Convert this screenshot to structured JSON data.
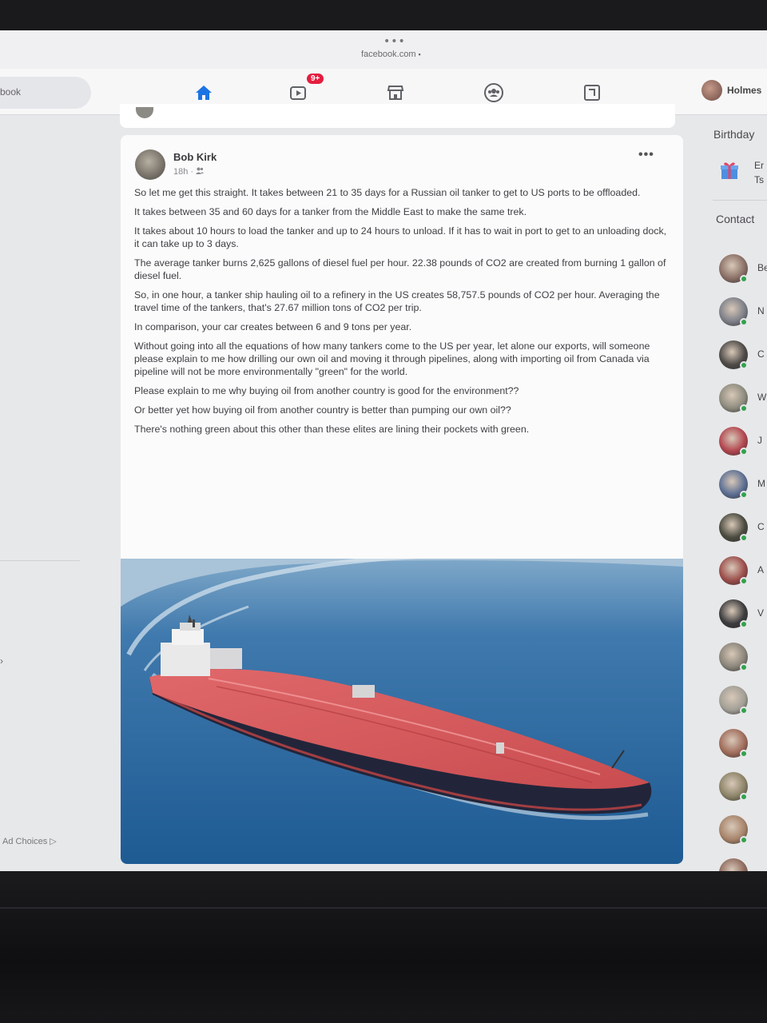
{
  "browser": {
    "menu_dots": "•••",
    "url": "facebook.com",
    "lock_icon": "lock-icon"
  },
  "nav": {
    "search_placeholder": "book",
    "watch_badge": "9+",
    "profile_name": "Holmes",
    "icons": [
      "home-icon",
      "watch-icon",
      "marketplace-icon",
      "groups-icon",
      "gaming-icon"
    ]
  },
  "left_sidebar": {
    "arrow": "›",
    "ad_choices": "Ad Choices ▷"
  },
  "post": {
    "author": "Bob Kirk",
    "time": "18h",
    "audience_icon": "friends-icon",
    "more": "•••",
    "paragraphs": [
      "So let me get this straight. It takes between 21 to 35 days for a Russian oil tanker to get to US ports to be offloaded.",
      "It takes between 35 and 60 days for a tanker from the Middle East to make the same trek.",
      "It takes about 10 hours to load the tanker and up to 24 hours to unload. If it has to wait in port to get to an unloading dock, it can take up to 3 days.",
      "The average tanker burns 2,625 gallons of diesel fuel per hour. 22.38 pounds of CO2 are created from burning 1 gallon of diesel fuel.",
      "So, in one hour, a  tanker ship hauling oil to a refinery in the US creates 58,757.5 pounds of CO2 per hour. Averaging the travel time of the tankers, that's 27.67 million tons of CO2 per trip.",
      "In comparison, your car creates between 6 and 9 tons per year.",
      "Without going into all the equations of how many tankers come to the US per year, let alone our exports, will someone please  explain to me how drilling our own oil and moving it through pipelines, along with importing oil from Canada via pipeline will not be more environmentally \"green\" for the world.",
      "Please explain to me why buying oil from another country is good for the environment??",
      "Or better yet how buying oil from another country is better than pumping our own oil??",
      "There's nothing green about this other than these elites are lining their pockets with green."
    ]
  },
  "right_sidebar": {
    "birthdays_title": "Birthday",
    "birthday_line1": "Er",
    "birthday_line2": "Ts",
    "contacts_title": "Contact",
    "contacts": [
      {
        "initial": "Be",
        "color": "#8a6f66"
      },
      {
        "initial": "N",
        "color": "#7d7f88"
      },
      {
        "initial": "C",
        "color": "#4d4a47"
      },
      {
        "initial": "W",
        "color": "#8e8c7f"
      },
      {
        "initial": "J",
        "color": "#b2464f"
      },
      {
        "initial": "M",
        "color": "#5c6f93"
      },
      {
        "initial": "C",
        "color": "#4b4b40"
      },
      {
        "initial": "A",
        "color": "#9b4d4a"
      },
      {
        "initial": "V",
        "color": "#3b3b3d"
      },
      {
        "initial": "",
        "color": "#8a857a"
      },
      {
        "initial": "",
        "color": "#a29f96"
      },
      {
        "initial": "",
        "color": "#a06b5a"
      },
      {
        "initial": "",
        "color": "#8c8368"
      },
      {
        "initial": "",
        "color": "#a7846a"
      },
      {
        "initial": "",
        "color": "#8f6a5e"
      }
    ]
  },
  "colors": {
    "accent": "#1b74e4",
    "badge": "#e41e3f",
    "online": "#31a24c"
  }
}
